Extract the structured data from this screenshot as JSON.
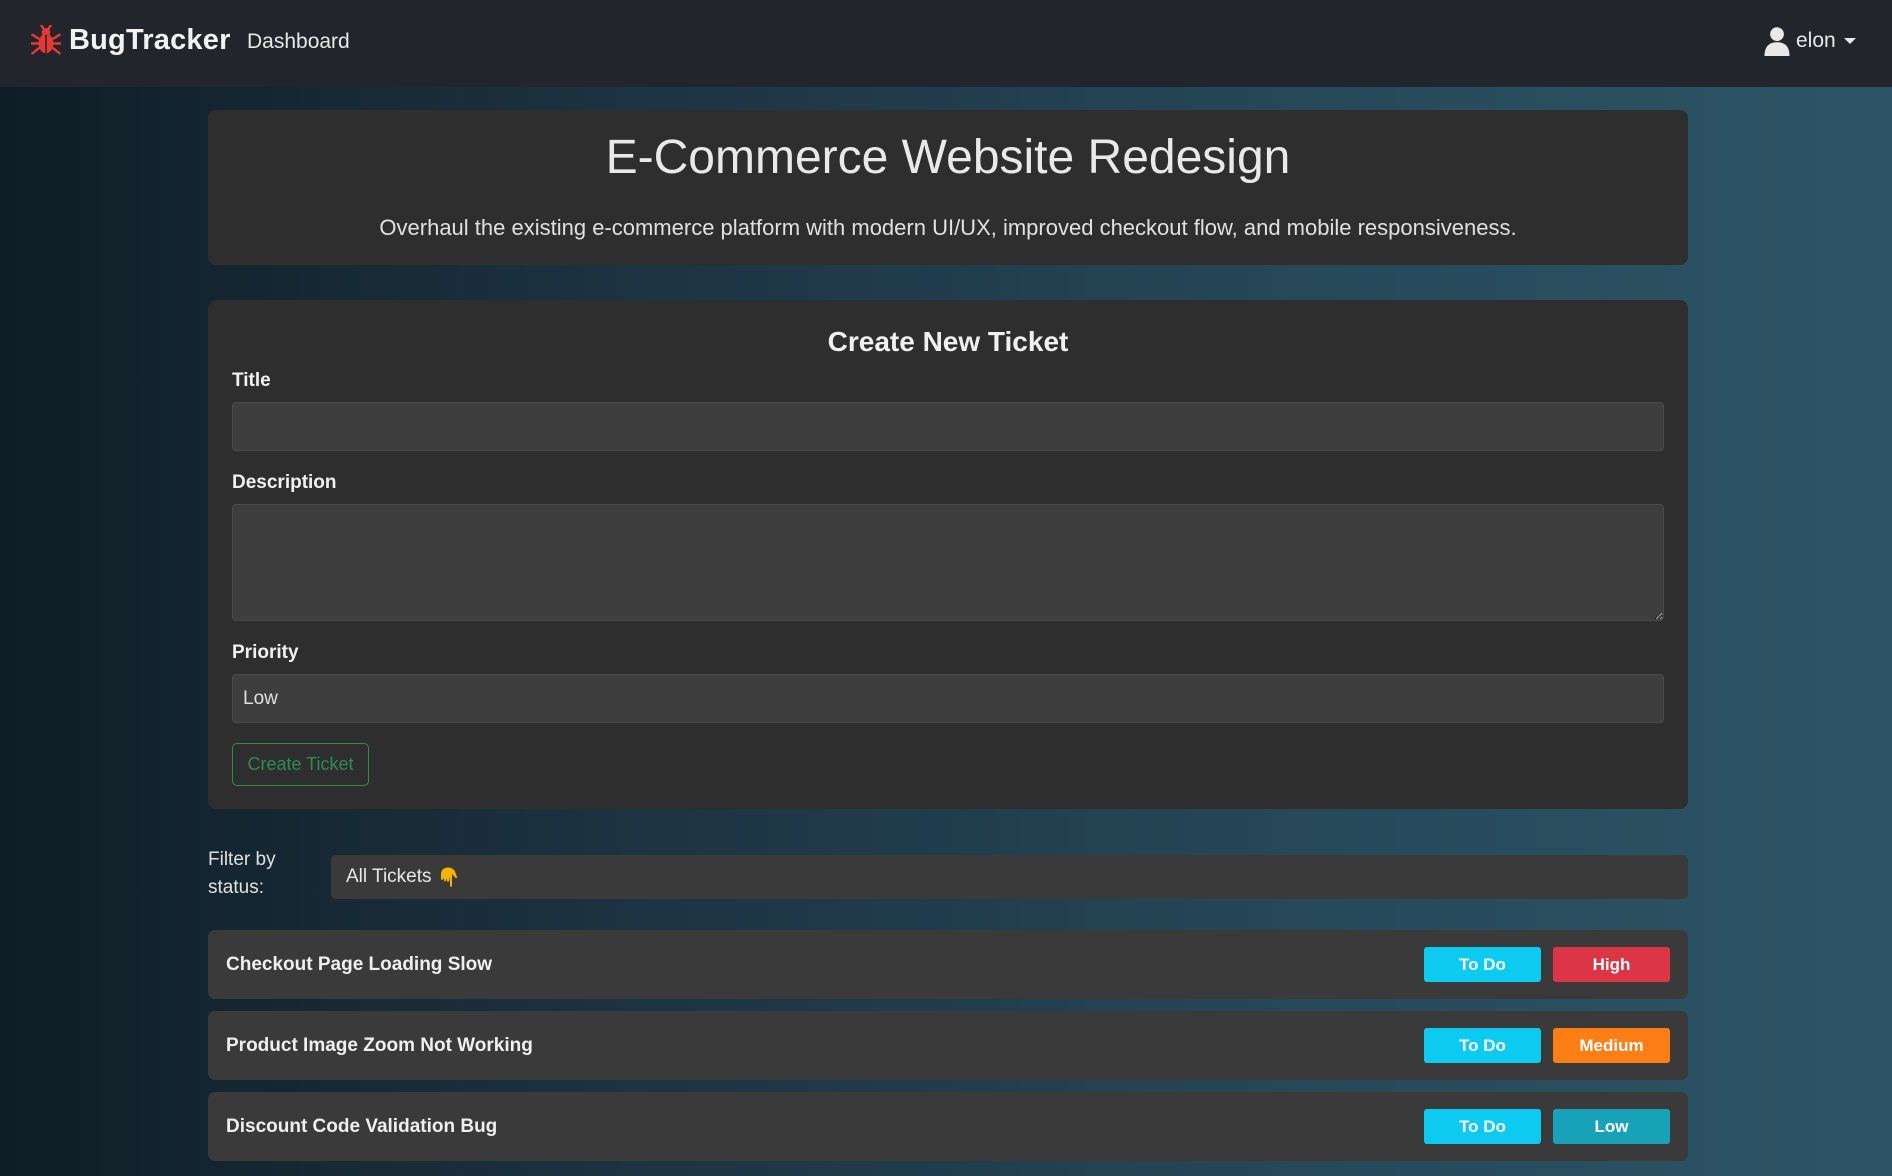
{
  "navbar": {
    "brand": "BugTracker",
    "links": [
      "Dashboard"
    ],
    "user": "elon"
  },
  "project": {
    "title": "E-Commerce Website Redesign",
    "description": "Overhaul the existing e-commerce platform with modern UI/UX, improved checkout flow, and mobile responsiveness."
  },
  "form": {
    "heading": "Create New Ticket",
    "title_label": "Title",
    "title_value": "",
    "description_label": "Description",
    "description_value": "",
    "priority_label": "Priority",
    "priority_value": "Low",
    "submit_label": "Create Ticket"
  },
  "filter": {
    "label": "Filter by status:",
    "selected": "All Tickets"
  },
  "tickets": [
    {
      "title": "Checkout Page Loading Slow",
      "status": "To Do",
      "priority": "High",
      "priority_color": "#dc3545"
    },
    {
      "title": "Product Image Zoom Not Working",
      "status": "To Do",
      "priority": "Medium",
      "priority_color": "#fd7e14"
    },
    {
      "title": "Discount Code Validation Bug",
      "status": "To Do",
      "priority": "Low",
      "priority_color": "#17a2b8"
    }
  ],
  "colors": {
    "brand_icon": "#e53935",
    "status_todo": "#0dcaf0",
    "create_button": "#2f8a56"
  },
  "icons": {
    "brand": "bug-icon",
    "user": "user-icon",
    "filter_point": "pointing-down-hand-icon"
  }
}
